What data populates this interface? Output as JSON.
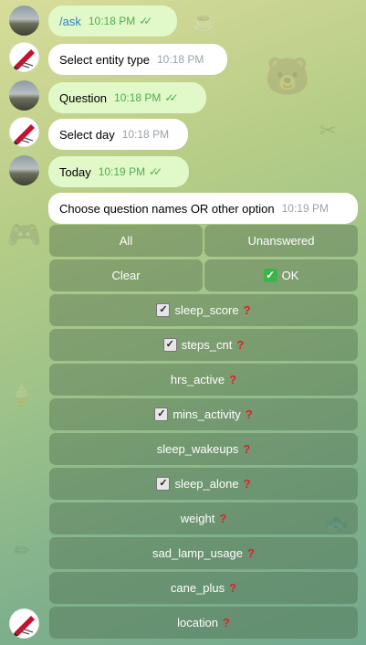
{
  "messages": [
    {
      "text": "/ask",
      "time": "10:18 PM",
      "read": true
    },
    {
      "text": "Select entity type",
      "time": "10:18 PM"
    },
    {
      "text": "Question",
      "time": "10:18 PM",
      "read": true
    },
    {
      "text": "Select day",
      "time": "10:18 PM"
    },
    {
      "text": "Today",
      "time": "10:19 PM",
      "read": true
    },
    {
      "text": "Choose question names OR other option",
      "time": "10:19 PM"
    }
  ],
  "keyboard": {
    "all": "All",
    "unanswered": "Unanswered",
    "clear": "Clear",
    "ok": "OK",
    "questions": [
      {
        "label": "sleep_score",
        "checked": true
      },
      {
        "label": "steps_cnt",
        "checked": true
      },
      {
        "label": "hrs_active",
        "checked": false
      },
      {
        "label": "mins_activity",
        "checked": true
      },
      {
        "label": "sleep_wakeups",
        "checked": false
      },
      {
        "label": "sleep_alone",
        "checked": true
      },
      {
        "label": "weight",
        "checked": false
      },
      {
        "label": "sad_lamp_usage",
        "checked": false
      },
      {
        "label": "cane_plus",
        "checked": false
      },
      {
        "label": "location",
        "checked": false
      }
    ]
  },
  "colors": {
    "outgoing_bubble": "#e1f8c8",
    "incoming_bubble": "#ffffff",
    "read_check": "#4fae4e",
    "question_mark": "#e0202a"
  },
  "icons": {
    "read_receipt": "double-check-icon",
    "checkbox": "checkbox-checked-icon",
    "ok": "white-check-mark-icon",
    "unanswered": "red-question-mark-icon"
  }
}
